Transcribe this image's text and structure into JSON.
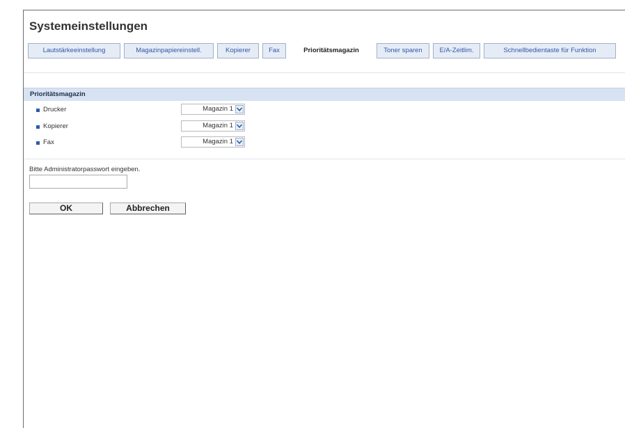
{
  "page_title": "Systemeinstellungen",
  "tabs": [
    {
      "label": "Lautstärkeeinstellung",
      "active": false
    },
    {
      "label": "Magazinpapiereinstell.",
      "active": false
    },
    {
      "label": "Kopierer",
      "active": false
    },
    {
      "label": "Fax",
      "active": false
    },
    {
      "label": "Prioritätsmagazin",
      "active": true
    },
    {
      "label": "Toner sparen",
      "active": false
    },
    {
      "label": "E/A-Zeitlim.",
      "active": false
    },
    {
      "label": "Schnellbedientaste für Funktion",
      "active": false
    }
  ],
  "section": {
    "title": "Prioritätsmagazin",
    "rows": [
      {
        "label": "Drucker",
        "value": "Magazin 1"
      },
      {
        "label": "Kopierer",
        "value": "Magazin 1"
      },
      {
        "label": "Fax",
        "value": "Magazin 1"
      }
    ]
  },
  "password": {
    "label": "Bitte Administratorpasswort eingeben.",
    "value": ""
  },
  "buttons": {
    "ok": "OK",
    "cancel": "Abbrechen"
  },
  "icons": {
    "row_bullet": "square-bullet-icon",
    "select_arrow": "chevron-down-icon"
  },
  "colors": {
    "tab_text": "#3057a6",
    "section_header_bg": "#d7e3f2",
    "bullet": "#2d5ba9"
  }
}
